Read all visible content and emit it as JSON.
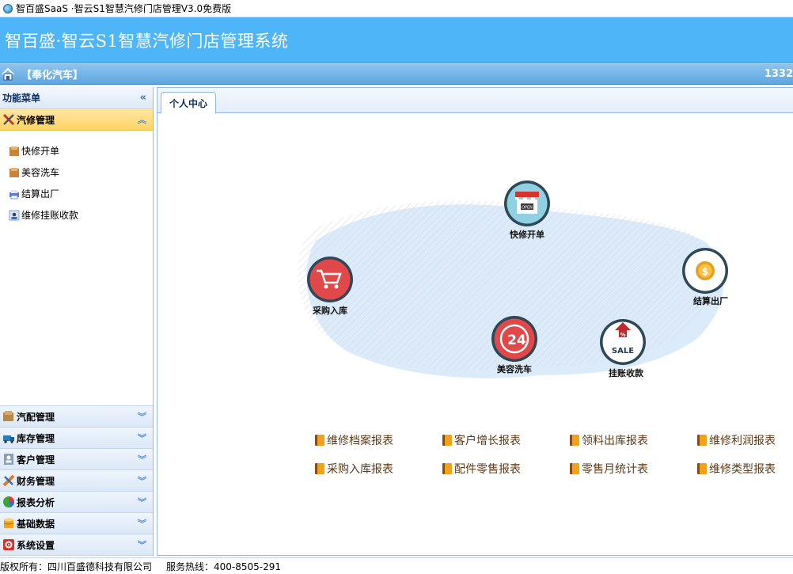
{
  "window": {
    "title": "智百盛SaaS ·智云S1智慧汽修门店管理V3.0免费版"
  },
  "banner": {
    "system_title": "智百盛·智云S1智慧汽修门店管理系统"
  },
  "infobar": {
    "shop_name": "【奉化汽车】",
    "user_id": "1332"
  },
  "sidebar": {
    "header": "功能菜单",
    "active_group": "汽修管理",
    "active_items": [
      {
        "label": "快修开单",
        "icon": "wallet-icon"
      },
      {
        "label": "美容洗车",
        "icon": "wallet-icon"
      },
      {
        "label": "结算出厂",
        "icon": "printer-icon"
      },
      {
        "label": "维修挂账收款",
        "icon": "user-card-icon"
      }
    ],
    "groups": [
      {
        "label": "汽配管理",
        "icon": "parts-icon"
      },
      {
        "label": "库存管理",
        "icon": "truck-icon"
      },
      {
        "label": "客户管理",
        "icon": "contacts-icon"
      },
      {
        "label": "财务管理",
        "icon": "finance-icon"
      },
      {
        "label": "报表分析",
        "icon": "pie-chart-icon"
      },
      {
        "label": "基础数据",
        "icon": "database-icon"
      },
      {
        "label": "系统设置",
        "icon": "settings-icon"
      }
    ]
  },
  "tabs": [
    {
      "label": "个人中心"
    }
  ],
  "dashboard": {
    "nodes": [
      {
        "label": "快修开单",
        "icon": "shop-open-icon"
      },
      {
        "label": "采购入库",
        "icon": "shopping-cart-icon"
      },
      {
        "label": "结算出厂",
        "icon": "coin-icon"
      },
      {
        "label": "美容洗车",
        "icon": "phone-24-icon"
      },
      {
        "label": "挂账收款",
        "icon": "sale-tag-icon"
      }
    ],
    "node_texts": {
      "open_sign": "OPEN",
      "hours": "24",
      "sale": "SALE",
      "percent": "%"
    },
    "reports": [
      "维修档案报表",
      "客户增长报表",
      "领料出库报表",
      "维修利润报表",
      "采购入库报表",
      "配件零售报表",
      "零售月统计表",
      "维修类型报表"
    ]
  },
  "footer": {
    "copyright": "版权所有：四川百盛德科技有限公司",
    "hotline": "服务热线：400-8505-291"
  }
}
